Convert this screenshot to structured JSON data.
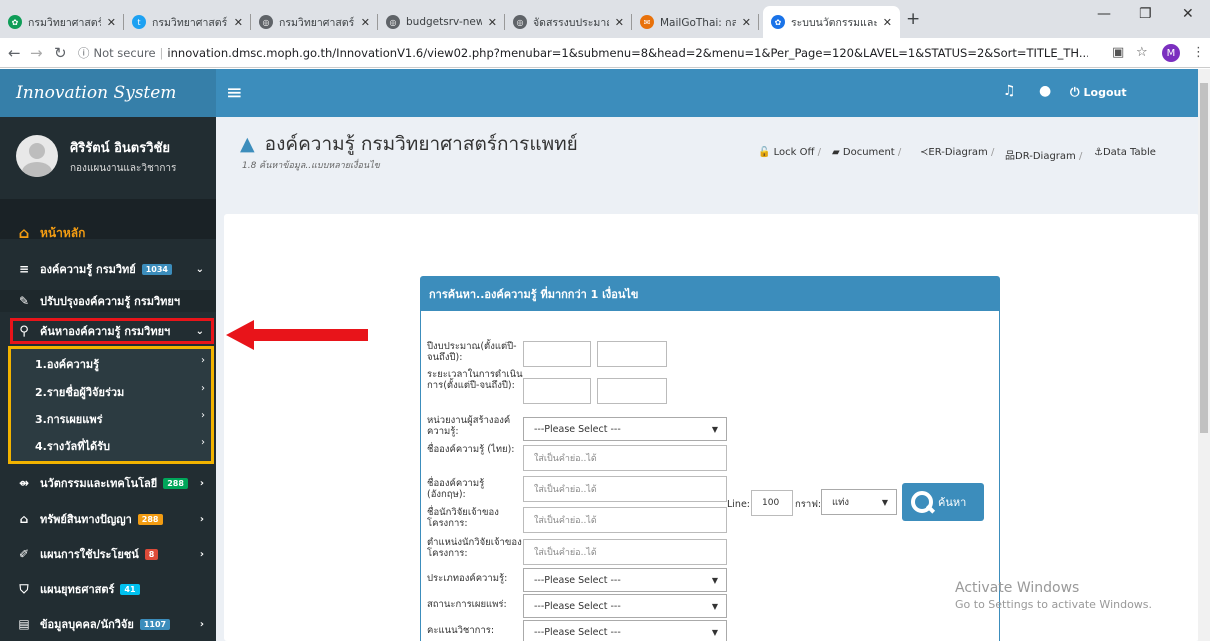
{
  "browser": {
    "tabs": [
      {
        "title": "กรมวิทยาศาสตร์การแ",
        "icon": "site-favicon",
        "color": "#0f9d58"
      },
      {
        "title": "กรมวิทยาศาสตร์การแ",
        "icon": "twitter-icon",
        "color": "#1da1f2"
      },
      {
        "title": "กรมวิทยาศาสตร์การแ",
        "icon": "globe-icon",
        "color": "#5f6368"
      },
      {
        "title": "budgetsrv-new.dn",
        "icon": "globe-icon",
        "color": "#5f6368"
      },
      {
        "title": "จัดสรรงบประมาณแผ",
        "icon": "globe-icon",
        "color": "#5f6368"
      },
      {
        "title": "MailGoThai: กล่องจ",
        "icon": "mail-icon",
        "color": "#e8710a"
      },
      {
        "title": "ระบบนวัตกรรมและผล",
        "icon": "site-favicon",
        "color": "#1a73e8"
      }
    ],
    "security": "Not secure",
    "url": "innovation.dmsc.moph.go.th/InnovationV1.6/view02.php?menubar=1&submenu=8&head=2&menu=1&Per_Page=120&LAVEL=1&STATUS=2&Sort=TITLE_TH...",
    "profile_initial": "M"
  },
  "app": {
    "brand": "Innovation System",
    "logout": "Logout",
    "user_name": "ศิริรัตน์ อินตรวิชัย",
    "user_dept": "กองแผนงานและวิชาการ",
    "accent": "#3c8dbc",
    "sidebar": {
      "home": "หน้าหลัก",
      "knowledge": "องค์ความรู้ กรมวิทย์",
      "knowledge_badge": "1034",
      "improve": "ปรับปรุงองค์ความรู้ กรมวิทยฯ",
      "search": "ค้นหาองค์ความรู้ กรมวิทยฯ",
      "sub": [
        "1.องค์ความรู้",
        "2.รายชื่อผู้วิจัยร่วม",
        "3.การเผยแพร่",
        "4.รางวัลที่ได้รับ"
      ],
      "innovation": "นวัตกรรมและเทคโนโลยี",
      "innovation_badge": "288",
      "ip": "ทรัพย์สินทางปัญญา",
      "ip_badge": "288",
      "utilization": "แผนการใช้ประโยชน์",
      "utilization_badge": "8",
      "strategy": "แผนยุทธศาสตร์",
      "strategy_badge": "41",
      "personnel": "ข้อมูลบุคคล/นักวิจัย",
      "personnel_badge": "1107"
    },
    "page_title": "องค์ความรู้ กรมวิทยาศาสตร์การแพทย์",
    "page_subtitle": "1.8 ค้นหาข้อมูล..แบบหลายเงื่อนไข",
    "breadcrumbs": [
      "Lock Off",
      "Document",
      "ER-Diagram",
      "DR-Diagram",
      "Data Table"
    ],
    "form": {
      "header": "การค้นหา..องค์ความรู้ ที่มากกว่า 1 เงื่อนไข",
      "fiscal_year": "ปีงบประมาณ(ตั้งแต่ปี-จนถึงปี):",
      "duration": "ระยะเวลาในการดำเนินการ(ตั้งแต่ปี-จนถึงปี):",
      "unit": "หน่วยงานผู้สร้างองค์ความรู้:",
      "name_th": "ชื่อองค์ความรู้ (ไทย):",
      "name_en": "ชื่อองค์ความรู้ (อังกฤษ):",
      "researcher": "ชื่อนักวิจัยเจ้าของโครงการ:",
      "position": "ตำแหน่งนักวิจัยเจ้าของโครงการ:",
      "type": "ประเภทองค์ความรู้:",
      "publish_status": "สถานะการเผยแพร่:",
      "academic_score": "คะแนนวิชาการ:",
      "select_placeholder": "---Please Select ---",
      "text_placeholder": "ใส่เป็นคำย่อ..ได้",
      "line_label": "Line:",
      "line_value": "100",
      "graph_label": "กราฟ:",
      "graph_value": "แท่ง",
      "search_button": "ค้นหา"
    }
  },
  "watermark": {
    "line1": "Activate Windows",
    "line2": "Go to Settings to activate Windows."
  }
}
